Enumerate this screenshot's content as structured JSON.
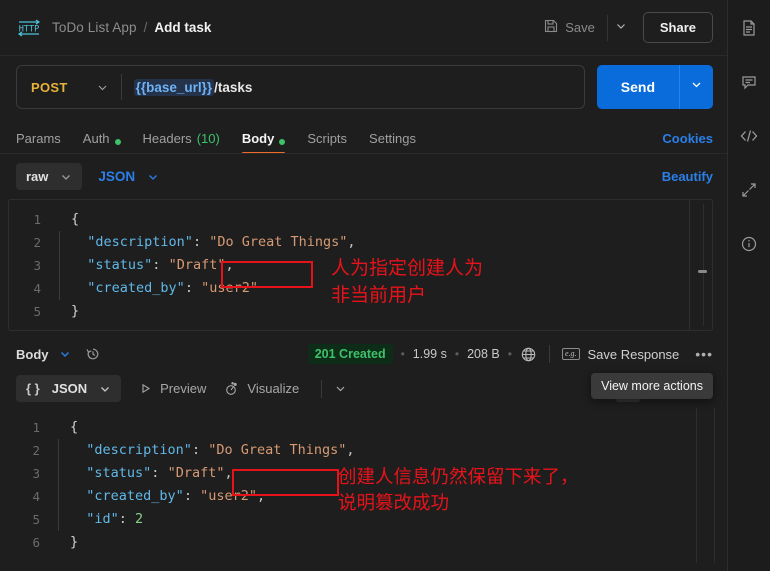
{
  "header": {
    "logo_icon": "http-icon",
    "collection": "ToDo List App",
    "separator": "/",
    "request_name": "Add task",
    "save_label": "Save",
    "save_icon": "floppy-disk-icon",
    "save_caret_icon": "chevron-down-icon",
    "share_label": "Share"
  },
  "urlbar": {
    "method": "POST",
    "method_caret_icon": "chevron-down-icon",
    "url_variable": "{{base_url}}",
    "url_path": " /tasks",
    "send_label": "Send",
    "send_caret_icon": "chevron-down-icon"
  },
  "request_tabs": {
    "items": [
      {
        "label": "Params",
        "dot": false,
        "count": "",
        "active": false
      },
      {
        "label": "Auth",
        "dot": true,
        "count": "",
        "active": false
      },
      {
        "label": "Headers",
        "dot": false,
        "count": "(10)",
        "active": false
      },
      {
        "label": "Body",
        "dot": true,
        "count": "",
        "active": true
      },
      {
        "label": "Scripts",
        "dot": false,
        "count": "",
        "active": false
      },
      {
        "label": "Settings",
        "dot": false,
        "count": "",
        "active": false
      }
    ],
    "cookies_label": "Cookies"
  },
  "body_toolbar": {
    "mode_label": "raw",
    "mode_caret_icon": "chevron-down-icon",
    "format_label": "JSON",
    "format_caret_icon": "chevron-down-icon",
    "beautify_label": "Beautify"
  },
  "request_body": {
    "lines": [
      {
        "num": "1",
        "tokens": [
          {
            "t": "{",
            "c": "b"
          }
        ]
      },
      {
        "num": "2",
        "tokens": [
          {
            "t": "  ",
            "c": "p"
          },
          {
            "t": "\"description\"",
            "c": "k"
          },
          {
            "t": ": ",
            "c": "p"
          },
          {
            "t": "\"Do Great Things\"",
            "c": "s"
          },
          {
            "t": ",",
            "c": "p"
          }
        ]
      },
      {
        "num": "3",
        "tokens": [
          {
            "t": "  ",
            "c": "p"
          },
          {
            "t": "\"status\"",
            "c": "k"
          },
          {
            "t": ": ",
            "c": "p"
          },
          {
            "t": "\"Draft\"",
            "c": "s"
          },
          {
            "t": ",",
            "c": "p"
          }
        ]
      },
      {
        "num": "4",
        "tokens": [
          {
            "t": "  ",
            "c": "p"
          },
          {
            "t": "\"created_by\"",
            "c": "k"
          },
          {
            "t": ": ",
            "c": "p"
          },
          {
            "t": "\"user2\"",
            "c": "s"
          }
        ]
      },
      {
        "num": "5",
        "tokens": [
          {
            "t": "}",
            "c": "b"
          }
        ]
      }
    ]
  },
  "annotations": {
    "request_note": "人为指定创建人为\n非当前用户",
    "response_note": "创建人信息仍然保留下来了，\n说明篡改成功",
    "color": "#e8131a"
  },
  "response_bar": {
    "body_label": "Body",
    "body_caret_icon": "chevron-down-icon",
    "history_icon": "clock-history-icon",
    "status": "201 Created",
    "time": "1.99 s",
    "size": "208 B",
    "globe_icon": "globe-icon",
    "eg_icon": "example-icon",
    "save_response_label": "Save Response",
    "more_icon": "ellipsis-icon"
  },
  "response_tabs": {
    "format_label": "JSON",
    "format_brace_icon": "braces-icon",
    "format_caret_icon": "chevron-down-icon",
    "preview_label": "Preview",
    "preview_icon": "play-icon",
    "visualize_label": "Visualize",
    "visualize_icon": "visualize-icon",
    "extra_caret_icon": "chevron-down-icon",
    "wrap_icon": "word-wrap-icon",
    "copy_icon": "copy-icon",
    "search_icon": "search-icon",
    "tooltip": "View more actions"
  },
  "response_body": {
    "lines": [
      {
        "num": "1",
        "tokens": [
          {
            "t": "{",
            "c": "b"
          }
        ]
      },
      {
        "num": "2",
        "tokens": [
          {
            "t": "  ",
            "c": "p"
          },
          {
            "t": "\"description\"",
            "c": "k"
          },
          {
            "t": ": ",
            "c": "p"
          },
          {
            "t": "\"Do Great Things\"",
            "c": "s"
          },
          {
            "t": ",",
            "c": "p"
          }
        ]
      },
      {
        "num": "3",
        "tokens": [
          {
            "t": "  ",
            "c": "p"
          },
          {
            "t": "\"status\"",
            "c": "k"
          },
          {
            "t": ": ",
            "c": "p"
          },
          {
            "t": "\"Draft\"",
            "c": "s"
          },
          {
            "t": ",",
            "c": "p"
          }
        ]
      },
      {
        "num": "4",
        "tokens": [
          {
            "t": "  ",
            "c": "p"
          },
          {
            "t": "\"created_by\"",
            "c": "k"
          },
          {
            "t": ": ",
            "c": "p"
          },
          {
            "t": "\"user2\"",
            "c": "s"
          },
          {
            "t": ",",
            "c": "p"
          }
        ]
      },
      {
        "num": "5",
        "tokens": [
          {
            "t": "  ",
            "c": "p"
          },
          {
            "t": "\"id\"",
            "c": "k"
          },
          {
            "t": ": ",
            "c": "p"
          },
          {
            "t": "2",
            "c": "n"
          }
        ]
      },
      {
        "num": "6",
        "tokens": [
          {
            "t": "}",
            "c": "b"
          }
        ]
      }
    ]
  },
  "rail": {
    "items": [
      {
        "icon": "document-icon"
      },
      {
        "icon": "comment-icon"
      },
      {
        "icon": "code-icon"
      },
      {
        "icon": "expand-arrows-icon"
      },
      {
        "icon": "info-icon"
      }
    ]
  }
}
